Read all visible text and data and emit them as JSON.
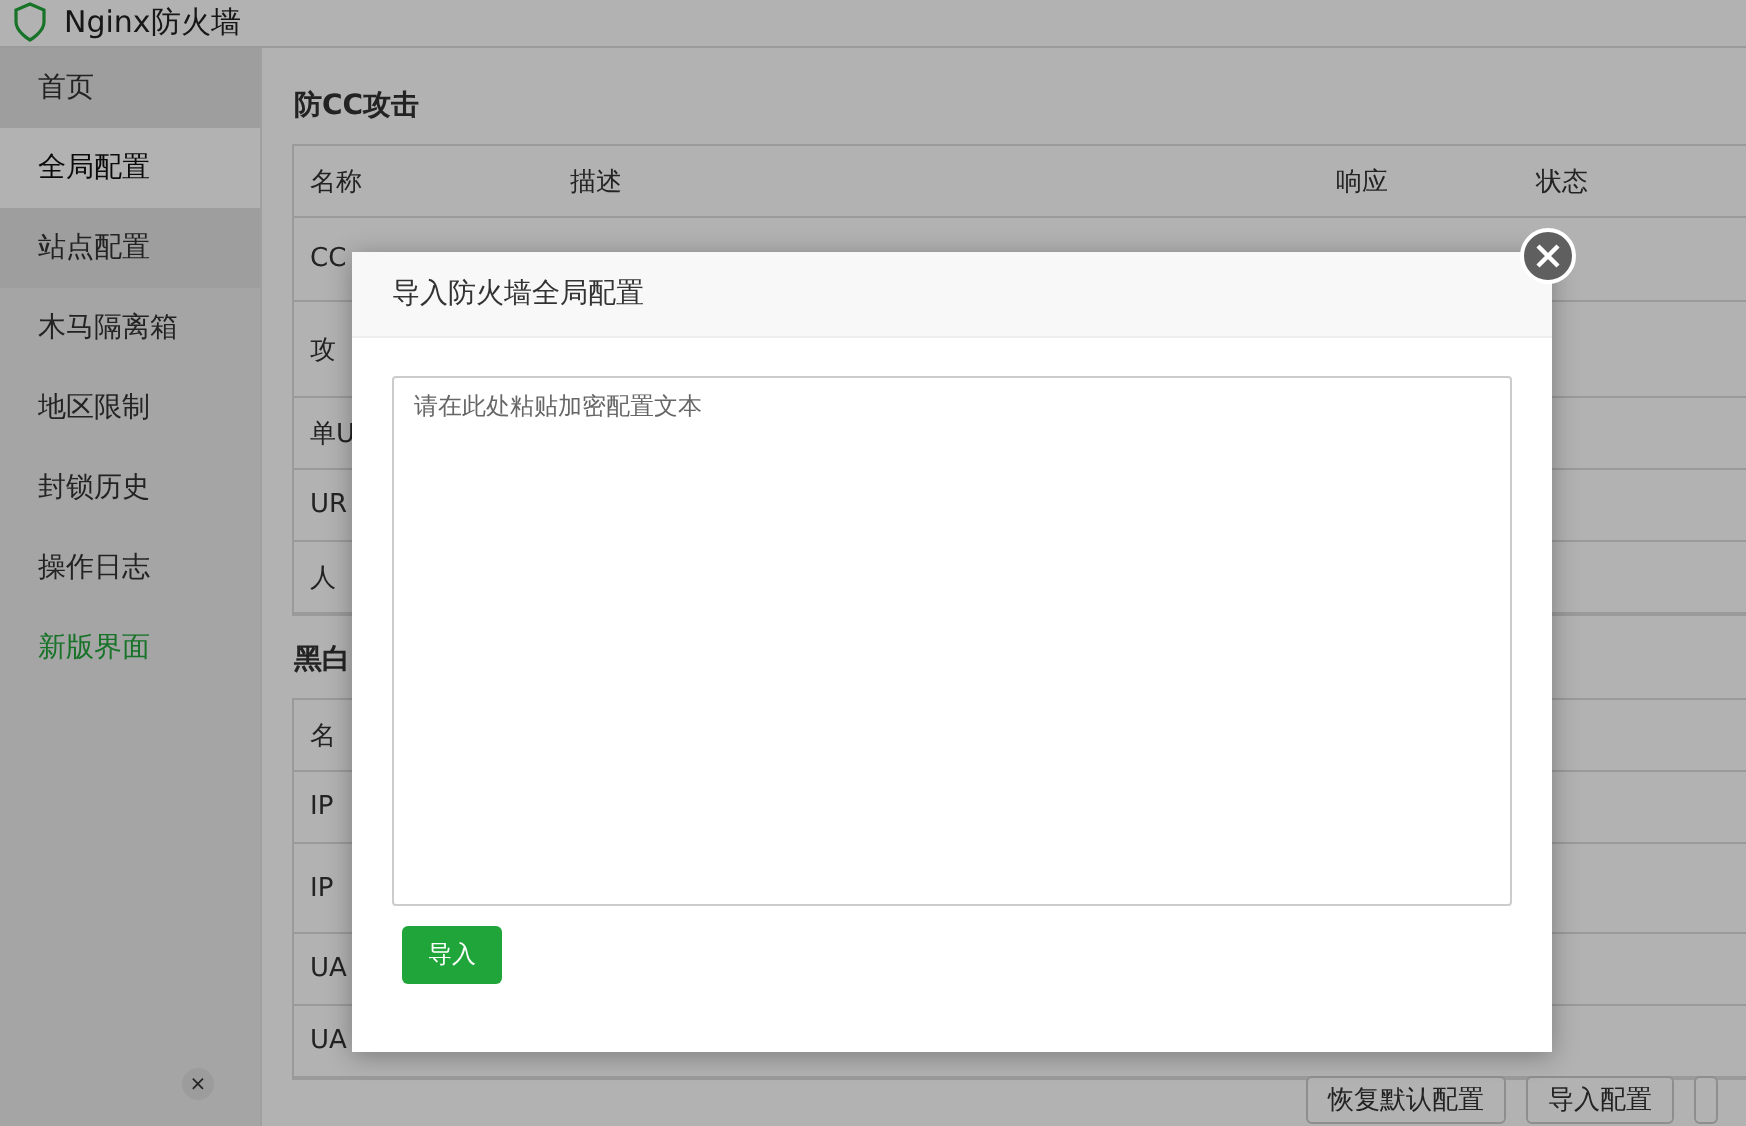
{
  "window": {
    "title": "Nginx防火墙"
  },
  "sidebar": {
    "items": [
      {
        "label": "首页",
        "selected": false,
        "kind": "dark"
      },
      {
        "label": "全局配置",
        "selected": true,
        "kind": "plain"
      },
      {
        "label": "站点配置",
        "selected": false,
        "kind": "dark"
      },
      {
        "label": "木马隔离箱",
        "selected": false,
        "kind": "plain"
      },
      {
        "label": "地区限制",
        "selected": false,
        "kind": "plain"
      },
      {
        "label": "封锁历史",
        "selected": false,
        "kind": "plain"
      },
      {
        "label": "操作日志",
        "selected": false,
        "kind": "plain"
      },
      {
        "label": "新版界面",
        "selected": false,
        "kind": "highlight"
      }
    ],
    "collapse_button": "×"
  },
  "sections": [
    {
      "title": "防CC攻击",
      "table": {
        "columns": [
          "名称",
          "描述",
          "响应",
          "状态"
        ],
        "rows": [
          {
            "name": "CC"
          },
          {
            "name": "攻"
          },
          {
            "name": "单U"
          },
          {
            "name": "UR"
          },
          {
            "name": "人"
          }
        ]
      }
    },
    {
      "title": "黑白",
      "table": {
        "columns": [
          "名"
        ],
        "rows": [
          {
            "name": "IP"
          },
          {
            "name": "IP"
          },
          {
            "name": "UA"
          },
          {
            "name": "UA"
          }
        ]
      }
    }
  ],
  "footer_buttons": [
    "恢复默认配置",
    "导入配置"
  ],
  "modal": {
    "title": "导入防火墙全局配置",
    "placeholder": "请在此处粘贴加密配置文本",
    "submit": "导入"
  }
}
